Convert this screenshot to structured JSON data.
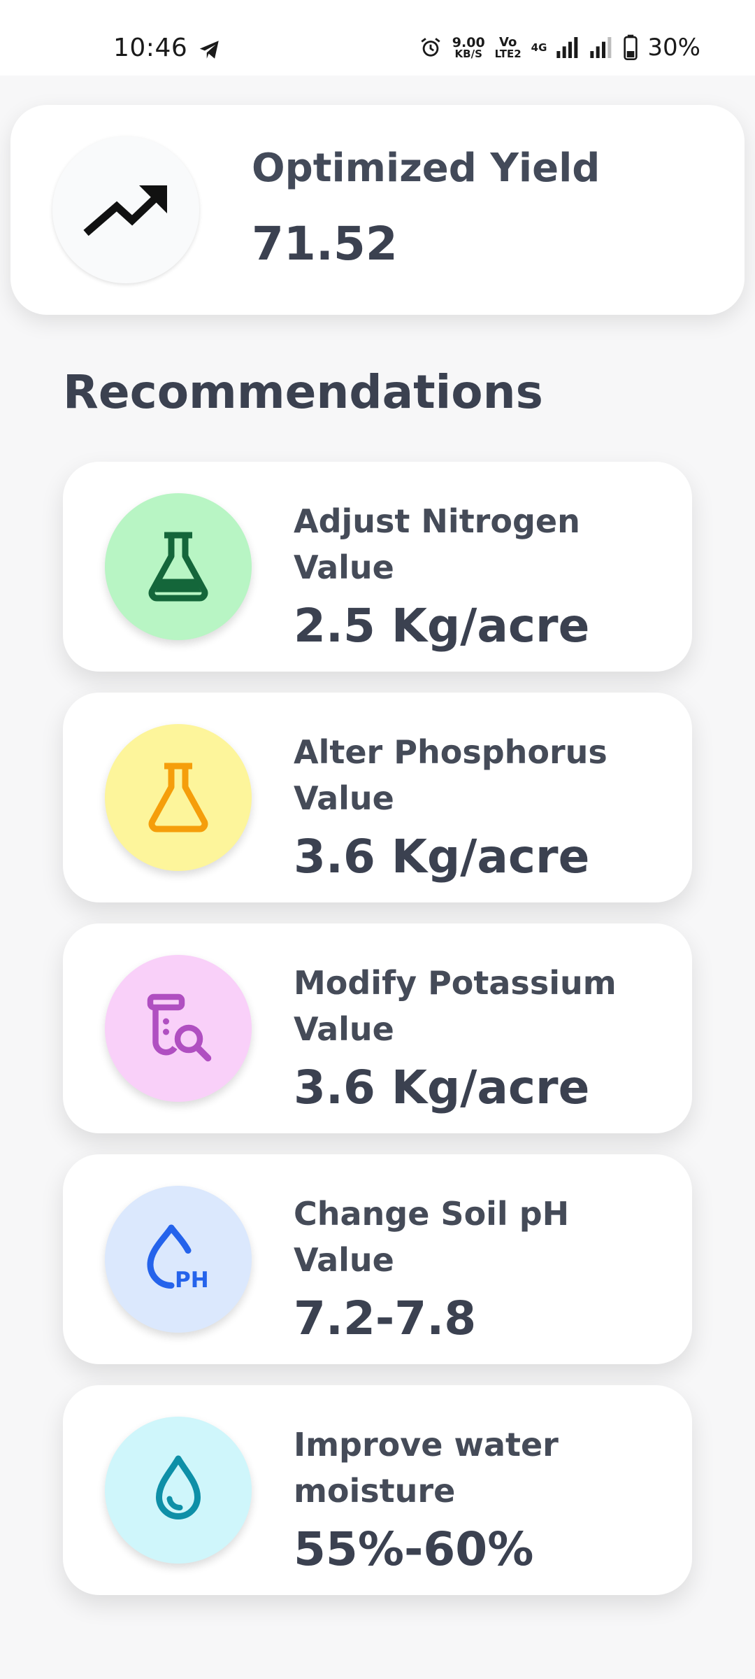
{
  "status_bar": {
    "time": "10:46",
    "net_speed_top": "9.00",
    "net_speed_bottom": "KB/S",
    "volte_top": "Vo",
    "volte_bottom": "LTE2",
    "network": "4G",
    "battery": "30%",
    "icons": [
      "telegram-icon",
      "alarm-icon",
      "signal-icon",
      "battery-icon"
    ]
  },
  "yield": {
    "title": "Optimized Yield",
    "value": "71.52",
    "icon": "trending-up-icon"
  },
  "recommendations_title": "Recommendations",
  "recommendations": [
    {
      "label": "Adjust Nitrogen Value",
      "value": "2.5 Kg/acre",
      "icon": "flask-icon",
      "bg": "#b8f5c4",
      "fg": "#14663a"
    },
    {
      "label": "Alter Phosphorus Value",
      "value": "3.6 Kg/acre",
      "icon": "flask-outline-icon",
      "bg": "#fdf59b",
      "fg": "#f59e0b"
    },
    {
      "label": "Modify Potassium Value",
      "value": "3.6 Kg/acre",
      "icon": "test-tube-search-icon",
      "bg": "#f9d0f9",
      "fg": "#b04fc1"
    },
    {
      "label": "Change Soil pH Value",
      "value": "7.2-7.8",
      "icon": "ph-drop-icon",
      "bg": "#dbe8fd",
      "fg": "#2563eb"
    },
    {
      "label": "Improve water moisture",
      "value": "55%-60%",
      "icon": "water-drop-icon",
      "bg": "#cff6fb",
      "fg": "#0e8fa7"
    }
  ]
}
